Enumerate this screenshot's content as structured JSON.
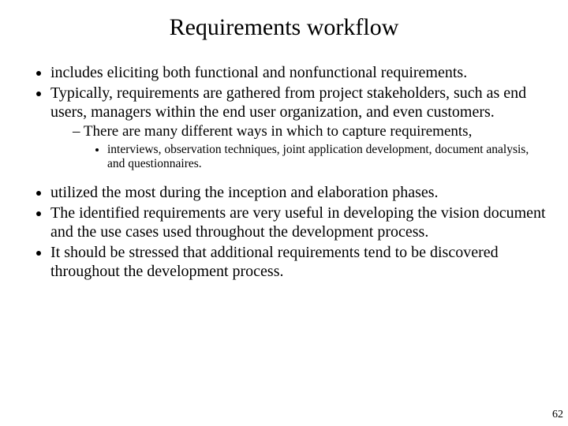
{
  "title": "Requirements workflow",
  "bullets": {
    "b1": "includes eliciting both functional and nonfunctional requirements.",
    "b2": "Typically, requirements are gathered from project stakeholders, such as end users, managers within the end user organization, and even customers.",
    "b2_sub1": "There are many different ways in which to capture requirements,",
    "b2_sub1_sub1": "interviews, observation techniques, joint application development, document analysis, and questionnaires.",
    "b3": "utilized the most during the inception and elaboration phases.",
    "b4": "The identified requirements are very useful in developing the vision document and the use cases used throughout the development process.",
    "b5": "It should be stressed that additional requirements tend to be discovered throughout the development process."
  },
  "page_number": "62"
}
